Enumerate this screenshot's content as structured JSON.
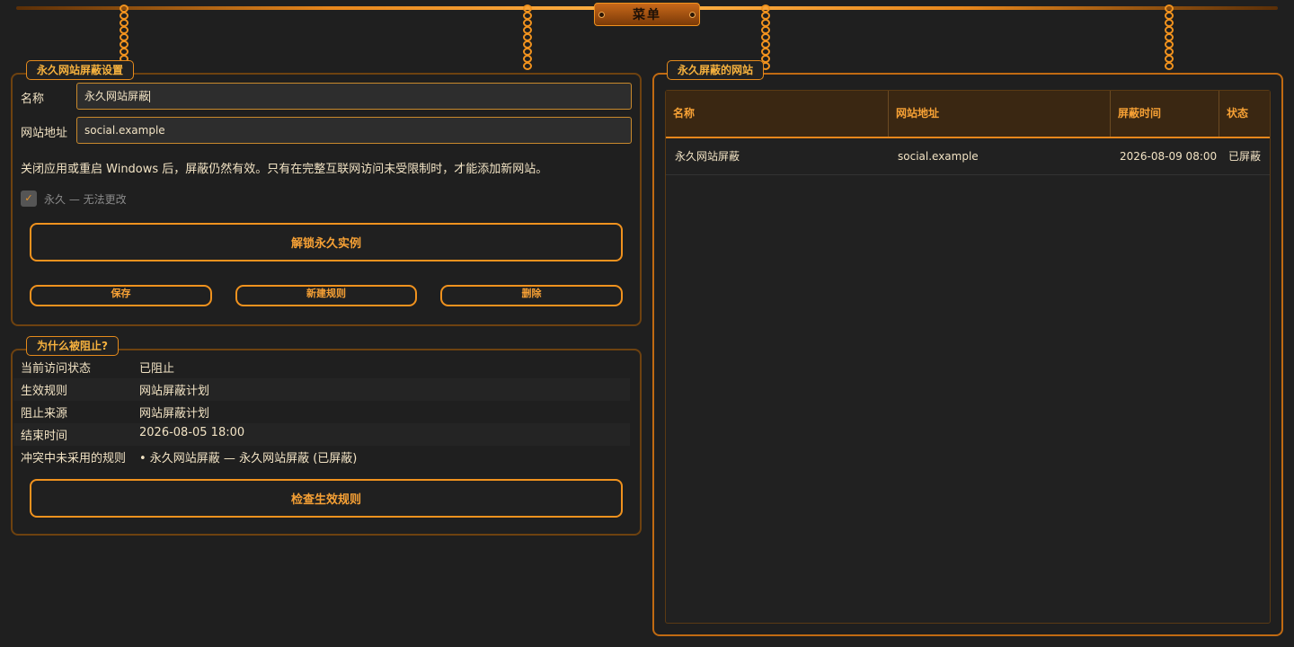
{
  "menu": {
    "label": "菜单"
  },
  "settings": {
    "legend": "永久网站屏蔽设置",
    "name_label": "名称",
    "name_value": "永久网站屏蔽",
    "url_label": "网站地址",
    "url_value": "social.example",
    "note": "关闭应用或重启 Windows 后，屏蔽仍然有效。只有在完整互联网访问未受限制时，才能添加新网站。",
    "permanent_checked": true,
    "permanent_label": "永久 — 无法更改",
    "unlock_button": "解锁永久实例",
    "small_buttons": [
      "保存",
      "新建规则",
      "删除"
    ]
  },
  "why": {
    "legend": "为什么被阻止?",
    "rows": [
      {
        "key": "当前访问状态",
        "value": "已阻止"
      },
      {
        "key": "生效规则",
        "value": "网站屏蔽计划"
      },
      {
        "key": "阻止来源",
        "value": "网站屏蔽计划"
      },
      {
        "key": "结束时间",
        "value": "2026-08-05 18:00"
      },
      {
        "key": "冲突中未采用的规则",
        "value": "• 永久网站屏蔽 — 永久网站屏蔽 (已屏蔽)"
      }
    ],
    "check_button": "检查生效规则"
  },
  "blocked": {
    "legend": "永久屏蔽的网站",
    "columns": [
      "名称",
      "网站地址",
      "屏蔽时间",
      "状态"
    ],
    "rows": [
      [
        "永久网站屏蔽",
        "social.example",
        "2026-08-09 08:00",
        "已屏蔽"
      ]
    ]
  },
  "colors": {
    "accent": "#f0921e",
    "background": "#1f1f1f",
    "text": "#f2e3c4"
  }
}
